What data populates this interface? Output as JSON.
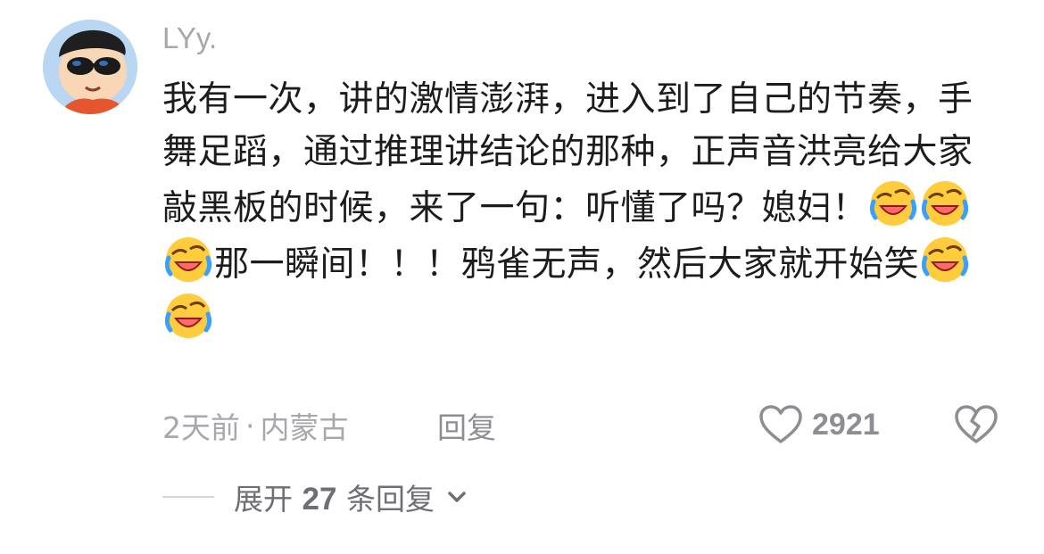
{
  "comment": {
    "username": "LYy.",
    "text_segments": [
      {
        "type": "text",
        "value": "我有一次，讲的激情澎湃，进入到了自己的节奏，手舞足蹈，通过推理讲结论的那种，正声音洪亮给大家敲黑板的时候，来了一句：听懂了吗？媳妇！"
      },
      {
        "type": "emoji",
        "name": "rolling-on-floor-laughing-icon"
      },
      {
        "type": "emoji",
        "name": "rolling-on-floor-laughing-icon"
      },
      {
        "type": "emoji",
        "name": "rolling-on-floor-laughing-icon"
      },
      {
        "type": "text",
        "value": "那一瞬间！！！鸦雀无声，然后大家就开始笑"
      },
      {
        "type": "emoji",
        "name": "rolling-on-floor-laughing-icon"
      },
      {
        "type": "emoji",
        "name": "rolling-on-floor-laughing-icon"
      }
    ],
    "text_part1": "我有一次，讲的激情澎湃，进入到了自己的节奏，手舞足蹈，通过推理讲结论的那种，正声音洪亮给大家敲黑板的时候，来了一句：听懂了吗？媳妇！",
    "text_part2": "那一瞬间！！！鸦雀无声，然后大家就开始笑",
    "time": "2天前",
    "separator": "·",
    "location": "内蒙古",
    "reply_label": "回复",
    "like_count": "2921",
    "icons": {
      "like": "heart-outline-icon",
      "dislike": "broken-heart-icon",
      "expand": "chevron-down-icon"
    }
  },
  "replies": {
    "expand_prefix": "展开",
    "count": "27",
    "expand_suffix": "条回复"
  },
  "colors": {
    "text": "#1c1c1e",
    "muted": "#a7a7ae",
    "secondary": "#8d8d94"
  }
}
